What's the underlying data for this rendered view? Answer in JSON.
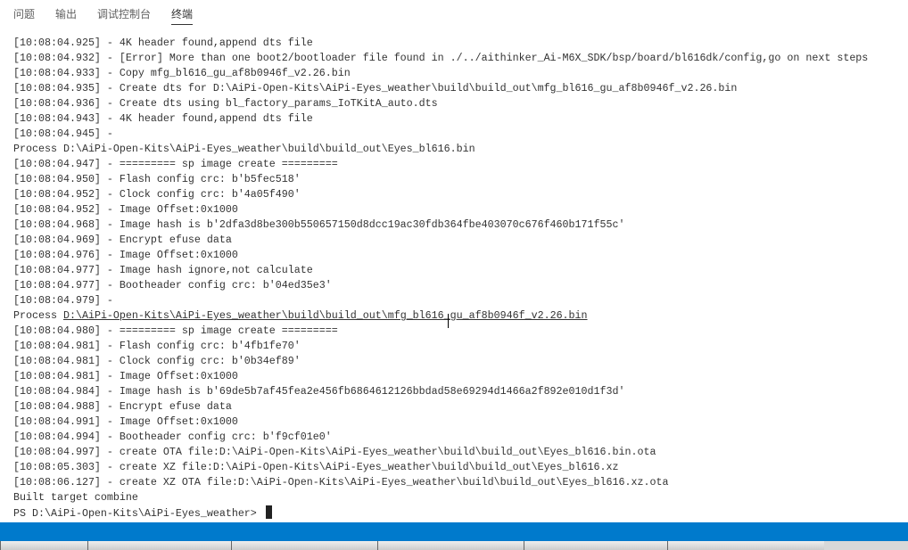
{
  "tabs": [
    {
      "label": "问题"
    },
    {
      "label": "输出"
    },
    {
      "label": "调试控制台"
    },
    {
      "label": "终端",
      "active": true
    }
  ],
  "terminal": {
    "lines": [
      "[10:08:04.925] - 4K header found,append dts file",
      "[10:08:04.932] - [Error] More than one boot2/bootloader file found in ./../aithinker_Ai-M6X_SDK/bsp/board/bl616dk/config,go on next steps",
      "[10:08:04.933] - Copy mfg_bl616_gu_af8b0946f_v2.26.bin",
      "[10:08:04.935] - Create dts for D:\\AiPi-Open-Kits\\AiPi-Eyes_weather\\build\\build_out\\mfg_bl616_gu_af8b0946f_v2.26.bin",
      "[10:08:04.936] - Create dts using bl_factory_params_IoTKitA_auto.dts",
      "[10:08:04.943] - 4K header found,append dts file",
      "[10:08:04.945] - ",
      "Process D:\\AiPi-Open-Kits\\AiPi-Eyes_weather\\build\\build_out\\Eyes_bl616.bin",
      "[10:08:04.947] - ========= sp image create =========",
      "[10:08:04.950] - Flash config crc: b'b5fec518'",
      "[10:08:04.952] - Clock config crc: b'4a05f490'",
      "[10:08:04.952] - Image Offset:0x1000",
      "[10:08:04.968] - Image hash is b'2dfa3d8be300b550657150d8dcc19ac30fdb364fbe403070c676f460b171f55c'",
      "[10:08:04.969] - Encrypt efuse data",
      "[10:08:04.976] - Image Offset:0x1000",
      "[10:08:04.977] - Image hash ignore,not calculate",
      "[10:08:04.977] - Bootheader config crc: b'04ed35e3'",
      "[10:08:04.979] - "
    ],
    "process_prefix": "Process ",
    "process_link": "D:\\AiPi-Open-Kits\\AiPi-Eyes_weather\\build\\build_out\\mfg_bl616_gu_af8b0946f_v2.26.bin",
    "lines2": [
      "[10:08:04.980] - ========= sp image create =========",
      "[10:08:04.981] - Flash config crc: b'4fb1fe70'",
      "[10:08:04.981] - Clock config crc: b'0b34ef89'",
      "[10:08:04.981] - Image Offset:0x1000",
      "[10:08:04.984] - Image hash is b'69de5b7af45fea2e456fb6864612126bbdad58e69294d1466a2f892e010d1f3d'",
      "[10:08:04.988] - Encrypt efuse data",
      "[10:08:04.991] - Image Offset:0x1000",
      "[10:08:04.994] - Bootheader config crc: b'f9cf01e0'",
      "[10:08:04.997] - create OTA file:D:\\AiPi-Open-Kits\\AiPi-Eyes_weather\\build\\build_out\\Eyes_bl616.bin.ota",
      "[10:08:05.303] - create XZ file:D:\\AiPi-Open-Kits\\AiPi-Eyes_weather\\build\\build_out\\Eyes_bl616.xz",
      "[10:08:06.127] - create XZ OTA file:D:\\AiPi-Open-Kits\\AiPi-Eyes_weather\\build\\build_out\\Eyes_bl616.xz.ota",
      "Built target combine"
    ],
    "prompt": "PS D:\\AiPi-Open-Kits\\AiPi-Eyes_weather> "
  },
  "colors": {
    "status_bar": "#007acc"
  }
}
